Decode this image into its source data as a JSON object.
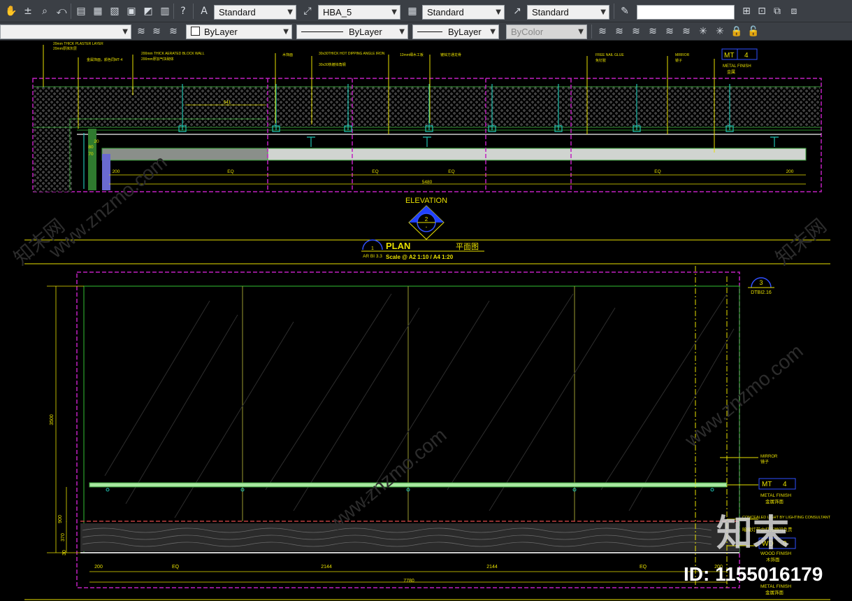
{
  "toolbar1": {
    "text_style": "Standard",
    "dim_style": "HBA_5",
    "table_style": "Standard",
    "mleader_style": "Standard",
    "search_value": ""
  },
  "toolbar2": {
    "layer_value": "",
    "color": "ByLayer",
    "linetype": "ByLayer",
    "lineweight": "ByLayer",
    "plotstyle": "ByColor"
  },
  "elevation": {
    "notes": [
      "20mm THICK PLASTER LAYER",
      "20mm厚抹灰层",
      "200mm THICK AERATED BLOCK WALL",
      "200mm厚加气块砌体",
      "金属饰面，颜色同MT-4",
      "木饰面",
      "30x30THICK HOT DIPPING ANGLE IRON",
      "30x30热镀锌角钢",
      "12mm细木工板",
      "镀锌方通龙骨",
      "FREE NAIL GLUE",
      "免钉胶",
      "MIRROR",
      "镜子",
      "METAL FINISH",
      "金属"
    ],
    "dims": [
      "541",
      "200",
      "EQ",
      "EQ",
      "EQ",
      "EQ",
      "200",
      "5480",
      "80",
      "70",
      "20"
    ],
    "tag_code": "MT",
    "tag_num": "4",
    "title": "ELEVATION",
    "marker_num": "2",
    "marker_sheet": "-"
  },
  "plan": {
    "marker_num": "1",
    "marker_sheet": "AR BI 3.3",
    "title": "PLAN",
    "title_cn": "平面图",
    "scale": "Scale @ A2 1:10 / A4 1:20"
  },
  "lower": {
    "detail_num": "3",
    "detail_sheet": "DTBI2.16",
    "mirror_en": "MIRROR",
    "mirror_cn": "镜子",
    "mt_code": "MT",
    "mt_num": "4",
    "metal_en": "METAL FINISH",
    "metal_cn": "金属饰面",
    "lighting_en": "CONCEALED LIGHT BY LIGHTING CONSULTANT",
    "lighting_cn": "暗藏灯带由灯光顾问负责",
    "wd_code": "WD",
    "wd_num": "9",
    "wood_en": "WOOD FINISH",
    "wood_cn": "木饰面",
    "metal2_en": "METAL FINISH",
    "metal2_cn": "金属饰面",
    "dim_height": "3500",
    "dim_a": "900",
    "dim_b": "370",
    "dim_c": "30",
    "dim_200a": "200",
    "dim_eq_a": "EQ",
    "dim_2144a": "2144",
    "dim_2144b": "2144",
    "dim_eq_b": "EQ",
    "dim_200b": "200",
    "dim_total": "7780"
  },
  "watermark": {
    "site": "www.znzmo.com",
    "logo": "知末",
    "logo_small": "知末网",
    "id": "ID: 1155016179"
  }
}
